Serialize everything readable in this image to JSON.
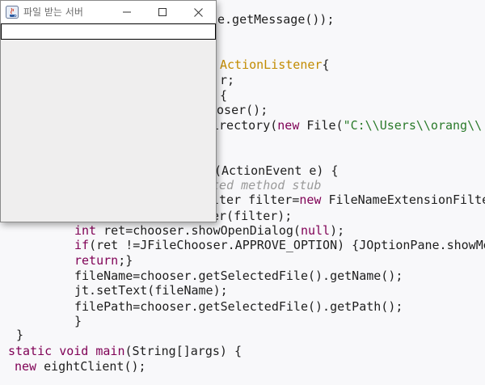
{
  "code_lines": [
    {
      "segments": [
        {
          "t": "e.getMessage());",
          "c": "plain"
        }
      ]
    },
    {
      "segments": [
        {
          "t": "ActionListener",
          "c": "cls"
        },
        {
          "t": "{",
          "c": "plain"
        }
      ]
    },
    {
      "segments": [
        {
          "t": "r;",
          "c": "plain"
        }
      ]
    },
    {
      "segments": [
        {
          "t": "{",
          "c": "plain"
        }
      ]
    },
    {
      "segments": [
        {
          "t": "ooser();",
          "c": "plain"
        }
      ]
    },
    {
      "segments": [
        {
          "t": "irectory(",
          "c": "plain"
        },
        {
          "t": "new",
          "c": "kw"
        },
        {
          "t": " File(",
          "c": "plain"
        },
        {
          "t": "\"C:\\\\Users\\\\orang\\\\",
          "c": "str"
        }
      ]
    },
    {
      "segments": [
        {
          "t": "(ActionEvent e) {",
          "c": "plain"
        }
      ]
    },
    {
      "segments": [
        {
          "t": "ted method stub",
          "c": "cmt"
        }
      ]
    },
    {
      "segments": [
        {
          "t": "lter filter=",
          "c": "plain"
        },
        {
          "t": "new",
          "c": "kw"
        },
        {
          "t": " FileNameExtensionFilte",
          "c": "plain"
        }
      ]
    },
    {
      "segments": [
        {
          "t": "er(filter);",
          "c": "plain"
        }
      ]
    },
    {
      "segments": [
        {
          "t": "int",
          "c": "kw"
        },
        {
          "t": " ret=chooser.showOpenDialog(",
          "c": "plain"
        },
        {
          "t": "null",
          "c": "kw"
        },
        {
          "t": ");",
          "c": "plain"
        }
      ]
    },
    {
      "segments": [
        {
          "t": "if",
          "c": "kw"
        },
        {
          "t": "(ret !=JFileChooser.APPROVE_OPTION) {JOptionPane.showMe",
          "c": "plain"
        }
      ]
    },
    {
      "segments": [
        {
          "t": "return",
          "c": "kw"
        },
        {
          "t": ";}",
          "c": "plain"
        }
      ]
    },
    {
      "segments": [
        {
          "t": "fileName=chooser.getSelectedFile().getName();",
          "c": "plain"
        }
      ]
    },
    {
      "segments": [
        {
          "t": "jt.setText(fileName);",
          "c": "plain"
        }
      ]
    },
    {
      "segments": [
        {
          "t": "filePath=chooser.getSelectedFile().getPath();",
          "c": "plain"
        }
      ]
    },
    {
      "segments": [
        {
          "t": "}",
          "c": "plain"
        }
      ]
    },
    {
      "segments": [
        {
          "t": "}",
          "c": "plain"
        }
      ]
    },
    {
      "segments": [
        {
          "t": "static",
          "c": "kw"
        },
        {
          "t": " ",
          "c": "plain"
        },
        {
          "t": "void",
          "c": "kw"
        },
        {
          "t": " ",
          "c": "plain"
        },
        {
          "t": "main",
          "c": "kw"
        },
        {
          "t": "(String[]args) {",
          "c": "plain"
        }
      ]
    },
    {
      "segments": [
        {
          "t": "new",
          "c": "kw"
        },
        {
          "t": " eightClient();",
          "c": "plain"
        }
      ]
    }
  ],
  "window": {
    "title": "파일 받는 서버",
    "text_field_value": "",
    "icons": {
      "app": "java-app-icon",
      "min": "minimize-icon",
      "max": "maximize-icon",
      "close": "close-icon"
    }
  }
}
